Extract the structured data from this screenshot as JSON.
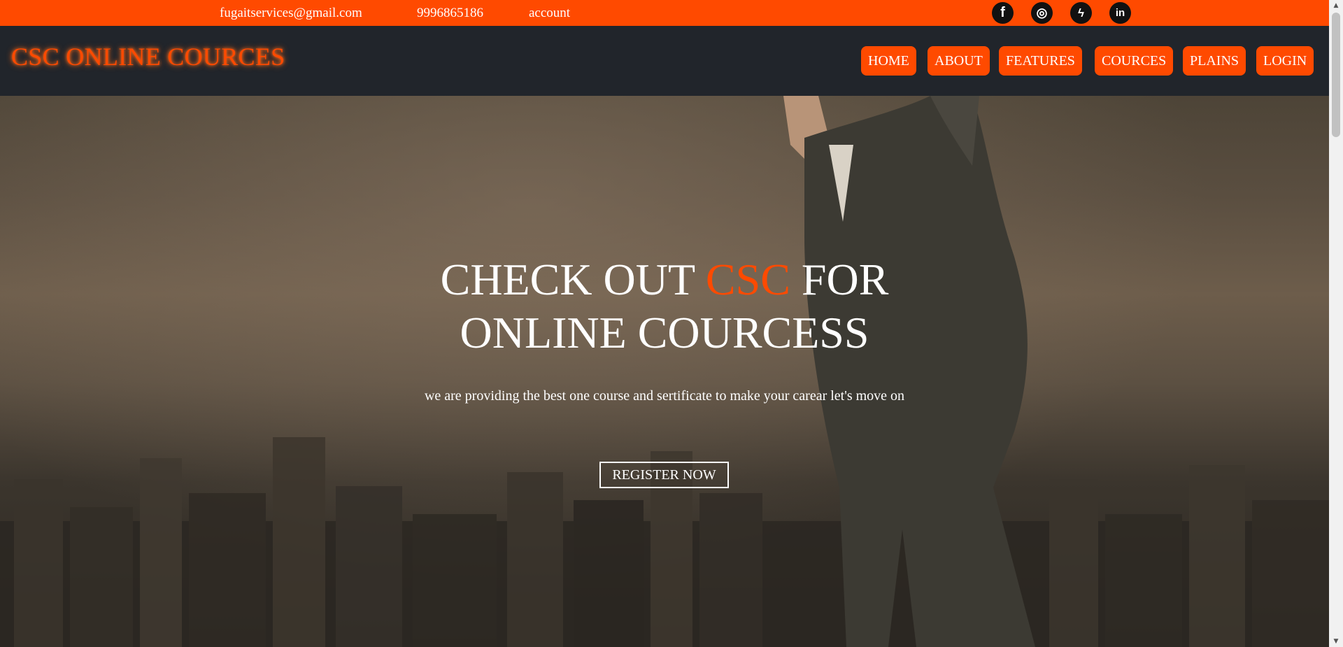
{
  "topbar": {
    "email": "fugaitservices@gmail.com",
    "phone": "9996865186",
    "account": "account",
    "socials": [
      {
        "icon": "facebook-icon",
        "glyph": "f"
      },
      {
        "icon": "instagram-icon",
        "glyph": "◎"
      },
      {
        "icon": "messenger-icon",
        "glyph": "ϟ"
      },
      {
        "icon": "linkedin-icon",
        "glyph": "in"
      }
    ]
  },
  "navbar": {
    "logo": "CSC ONLINE COURCES",
    "items": [
      "HOME",
      "ABOUT",
      "FEATURES",
      "COURCES",
      "PLAINS",
      "LOGIN"
    ]
  },
  "hero": {
    "title_part1": "CHECK OUT ",
    "title_accent": "CSC",
    "title_part2": " FOR",
    "title_line2": "ONLINE COURCESS",
    "subtitle": "we are providing the best one course and sertificate to make your carear let's move on",
    "cta": "REGISTER NOW"
  },
  "colors": {
    "accent": "#ff4a00",
    "navbar_bg": "#21252b"
  }
}
